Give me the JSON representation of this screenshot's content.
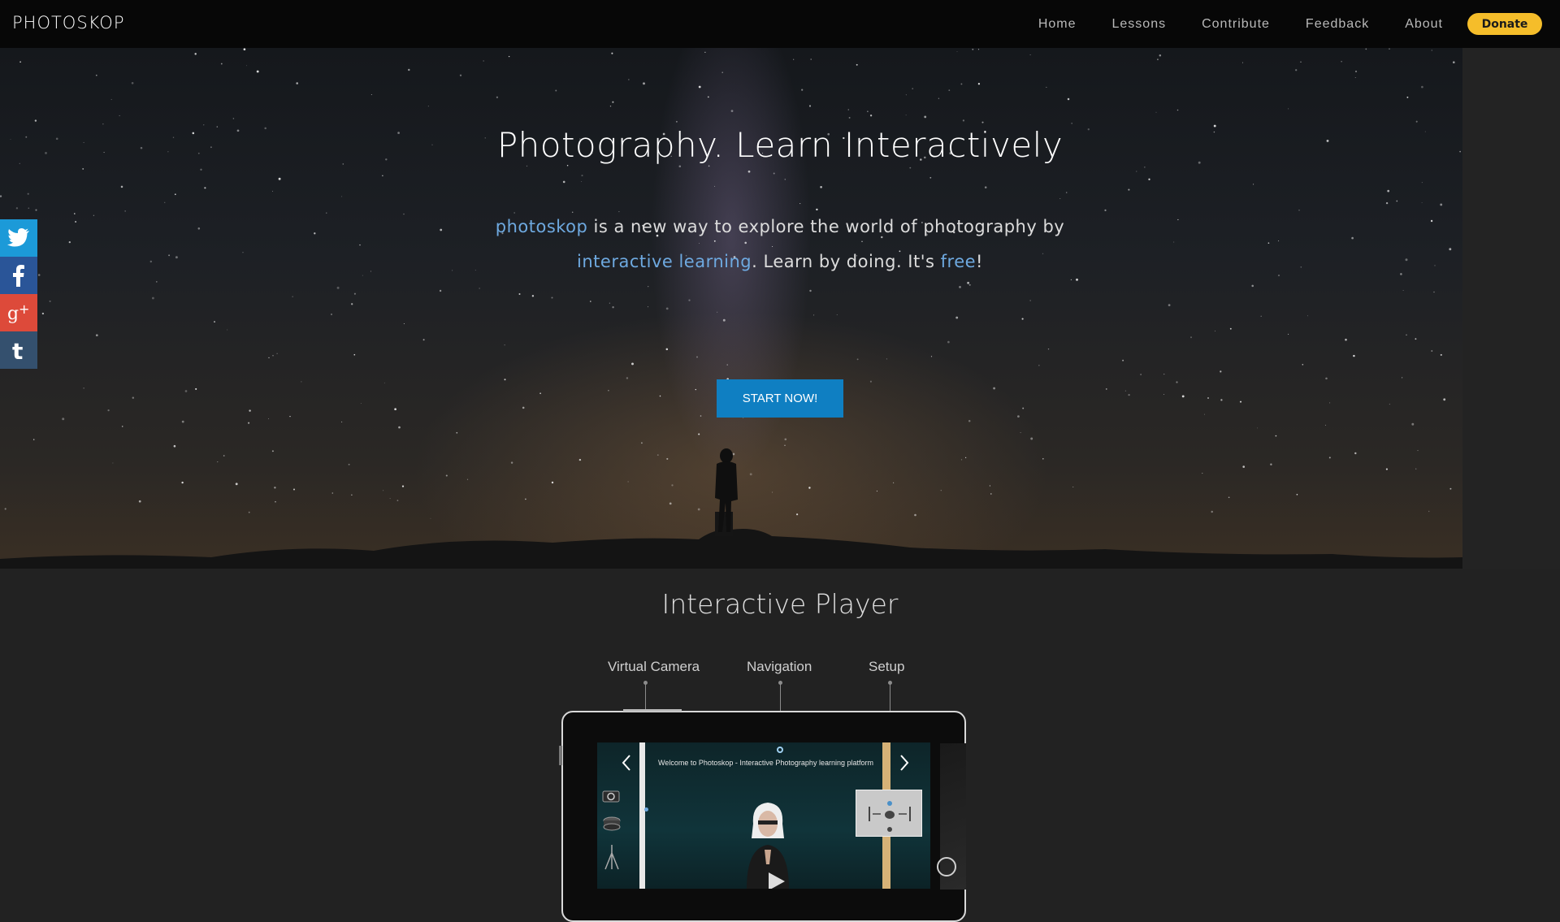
{
  "app": {
    "logo": "PHOTOSKOP"
  },
  "nav": {
    "items": [
      {
        "label": "Home"
      },
      {
        "label": "Lessons"
      },
      {
        "label": "Contribute"
      },
      {
        "label": "Feedback"
      },
      {
        "label": "About"
      }
    ],
    "donate_label": "Donate"
  },
  "hero": {
    "title": "Photography. Learn Interactively",
    "text": {
      "brand": "photoskop",
      "part1": " is a new way to explore the world of photography by ",
      "highlight": "interactive learning",
      "part2": ". Learn by doing. It's ",
      "free": "free",
      "end": "!"
    },
    "start_label": "START NOW!"
  },
  "social": {
    "items": [
      {
        "icon": "twitter-icon",
        "color": "#1c9ad8"
      },
      {
        "icon": "facebook-icon",
        "color": "#2a5598"
      },
      {
        "icon": "google-plus-icon",
        "color": "#dd4a3a"
      },
      {
        "icon": "tumblr-icon",
        "color": "#34506e"
      }
    ]
  },
  "player": {
    "title": "Interactive Player",
    "callouts": [
      "Virtual Camera",
      "Navigation",
      "Setup"
    ],
    "screen_caption": "Welcome to Photoskop - Interactive Photography learning platform"
  },
  "colors": {
    "accent": "#6ea9e0",
    "button": "#0f7fc2",
    "donate": "#f5bd2a"
  }
}
